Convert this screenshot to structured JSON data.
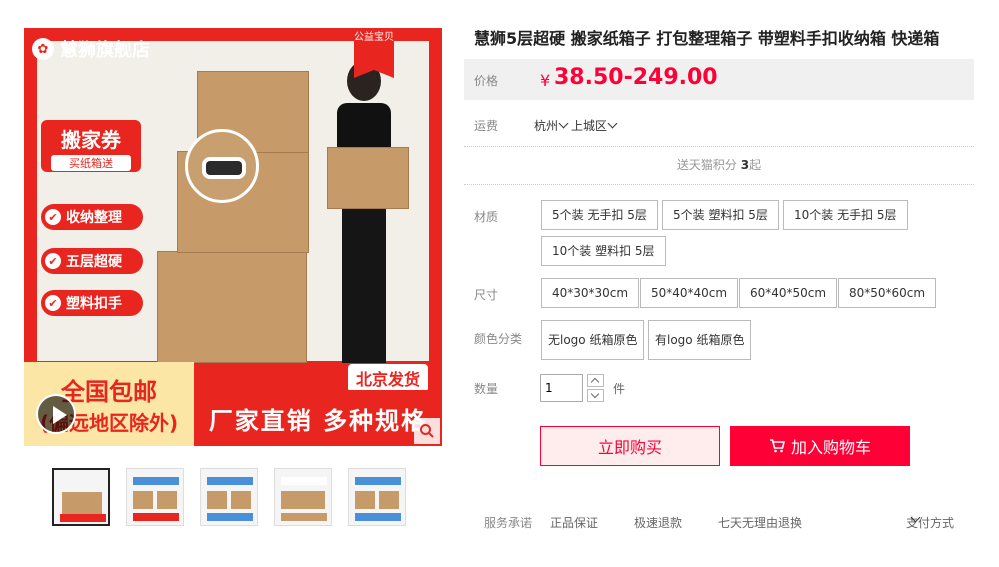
{
  "gallery": {
    "store_name": "慧狮旗舰店",
    "charity_badge": "公益宝贝",
    "coupon_title": "搬家券",
    "coupon_sub": "买纸箱送",
    "features": [
      "收纳整理",
      "五层超硬",
      "塑料扣手"
    ],
    "ship_origin": "北京发货",
    "free_shipping": "全国包邮",
    "exclusion": "(偏远地区除外)",
    "slogan": "厂家直销 多种规格",
    "thumbnails": 5,
    "active_thumbnail": 0
  },
  "product": {
    "title": "慧狮5层超硬 搬家纸箱子 打包整理箱子 带塑料手扣收纳箱 快递箱",
    "price_label": "价格",
    "currency": "¥",
    "price": "38.50-249.00",
    "shipping_label": "运费",
    "shipping_city": "杭州",
    "shipping_district": "上城区",
    "points_prefix": "送天猫积分 ",
    "points_value": "3",
    "points_suffix": "起"
  },
  "options": {
    "material_label": "材质",
    "materials": [
      "5个装 无手扣 5层",
      "5个装 塑料扣 5层",
      "10个装 无手扣 5层",
      "10个装 塑料扣 5层"
    ],
    "size_label": "尺寸",
    "sizes": [
      "40*30*30cm",
      "50*40*40cm",
      "60*40*50cm",
      "80*50*60cm"
    ],
    "color_label": "颜色分类",
    "colors": [
      "无logo 纸箱原色",
      "有logo 纸箱原色"
    ],
    "qty_label": "数量",
    "qty_value": "1",
    "qty_unit": "件"
  },
  "actions": {
    "buy_now": "立即购买",
    "add_cart": "加入购物车"
  },
  "service": {
    "label": "服务承诺",
    "items": [
      "正品保证",
      "极速退款",
      "七天无理由退换"
    ],
    "payment": "支付方式"
  },
  "colors": {
    "accent": "#ff0036",
    "banner_red": "#e8261f",
    "cardboard": "#c79a6a"
  }
}
